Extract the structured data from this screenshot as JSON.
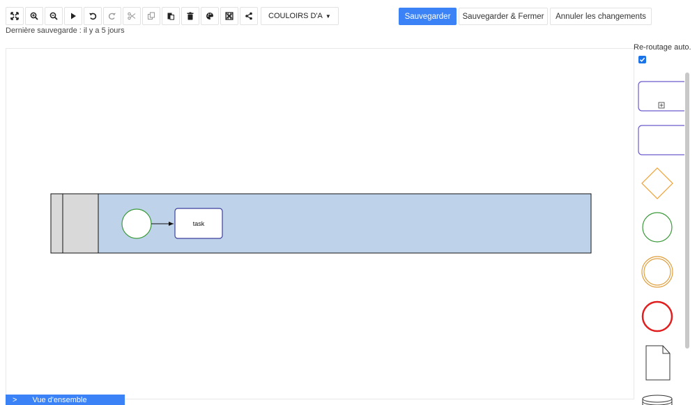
{
  "toolbar": {
    "buttons": [
      "fit-screen",
      "zoom-in",
      "zoom-out",
      "play",
      "undo",
      "redo",
      "cut",
      "copy",
      "paste",
      "delete",
      "color-palette",
      "grid",
      "share"
    ],
    "lanes_dropdown_label": "COULOIRS D'A"
  },
  "actions": {
    "save": "Sauvegarder",
    "save_close": "Sauvegarder & Fermer",
    "cancel": "Annuler les changements"
  },
  "status": {
    "last_save": "Dernière sauvegarde : il y a 5 jours"
  },
  "diagram": {
    "task_label": "task",
    "pool_fill": "#bed3ea",
    "lane_header_fill": "#d9d9d9",
    "start_event_stroke": "#3a9a3a",
    "task_stroke": "#3b3f9c"
  },
  "side_panel": {
    "auto_reroute_label": "Re-routage auto.",
    "auto_reroute_checked": true,
    "palette_items": [
      "subprocess-collapsed",
      "subprocess",
      "gateway",
      "start-event",
      "intermediate-event",
      "end-event",
      "data-object",
      "data-store"
    ]
  },
  "overview": {
    "label": "Vue d'ensemble"
  },
  "colors": {
    "primary": "#3b82f6",
    "gateway": "#f0a030",
    "start": "#3a9a3a",
    "intermediate": "#e0a040",
    "end": "#e02020",
    "subprocess": "#6a5acd"
  }
}
